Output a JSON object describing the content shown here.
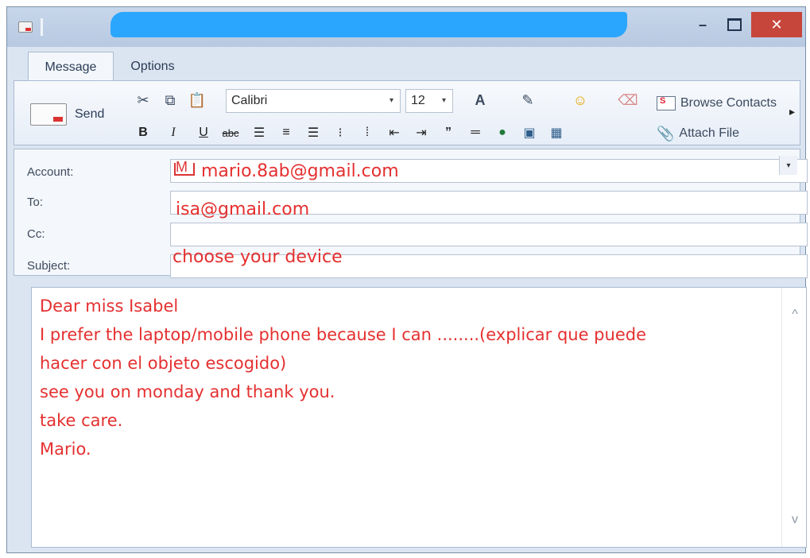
{
  "window": {
    "title": "",
    "controls": {
      "minimize": "–",
      "close": "✕"
    }
  },
  "tabs": [
    {
      "label": "Message"
    },
    {
      "label": "Options"
    }
  ],
  "ribbon": {
    "send_label": "Send",
    "font_family": "Calibri",
    "font_size": "12",
    "browse_contacts": "Browse Contacts",
    "attach_file": "Attach File",
    "format_buttons": [
      "B",
      "I",
      "U",
      "abc"
    ],
    "icons": [
      "cut-icon",
      "copy-icon",
      "paste-icon",
      "font-color-icon",
      "highlight-icon",
      "emoji-icon",
      "eraser-icon",
      "align-left-icon",
      "align-center-icon",
      "align-right-icon",
      "bullets-icon",
      "numbering-icon",
      "outdent-icon",
      "indent-icon",
      "quote-icon",
      "horizontal-rule-icon",
      "link-icon",
      "image-icon",
      "picture-icon",
      "contacts-card-icon",
      "paperclip-icon"
    ]
  },
  "fields": {
    "account_label": "Account:",
    "account_value": "mario.8ab@gmail.com",
    "to_label": "To:",
    "to_value": "isa@gmail.com",
    "cc_label": "Cc:",
    "cc_value": "",
    "subject_label": "Subject:",
    "subject_value": "choose your device"
  },
  "body": {
    "text": "Dear miss Isabel\nI prefer the laptop/mobile phone because I can ........(explicar que puede\nhacer con el objeto escogido)\nsee you on monday and thank you.\ntake care.\nMario."
  },
  "colors": {
    "handwriting": "#e53030",
    "close_button": "#c7463b",
    "redaction": "#23a3ff",
    "window_bg": "#dbe5f1"
  }
}
